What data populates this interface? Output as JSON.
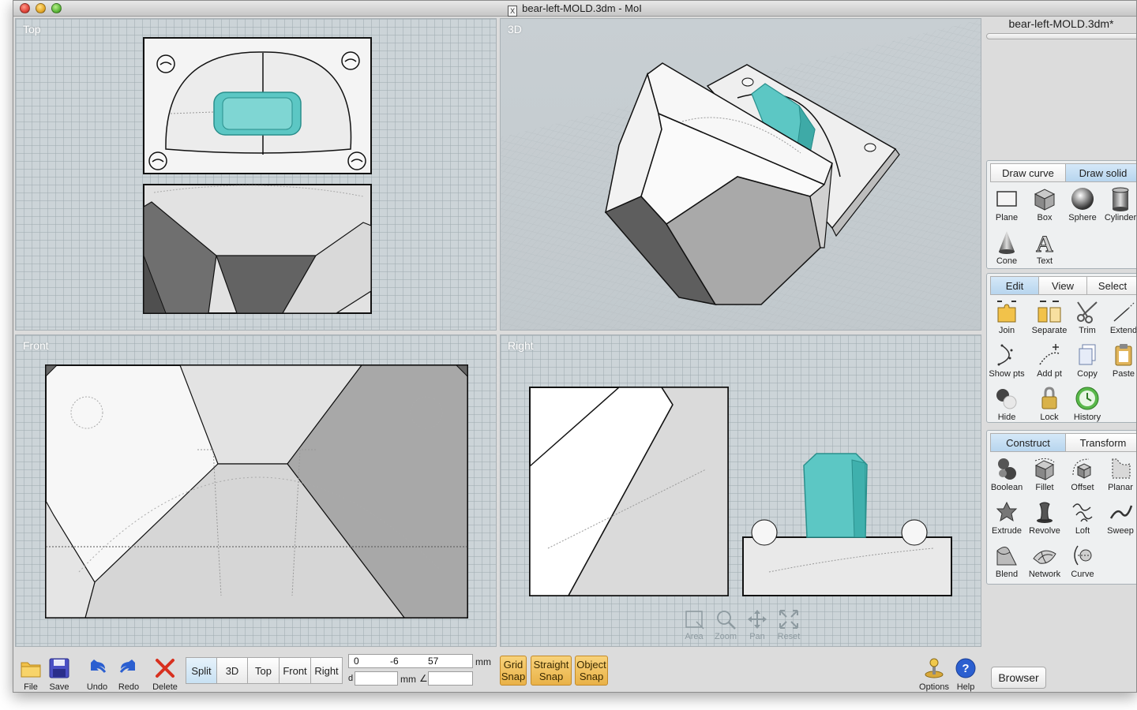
{
  "window": {
    "title": "bear-left-MOLD.3dm - MoI",
    "icon_glyph": "X"
  },
  "viewports": {
    "top": "Top",
    "perspective": "3D",
    "front": "Front",
    "right": "Right"
  },
  "nav_tools": {
    "area": "Area",
    "zoom": "Zoom",
    "pan": "Pan",
    "reset": "Reset"
  },
  "toolbar": {
    "file": "File",
    "save": "Save",
    "undo": "Undo",
    "redo": "Redo",
    "delete": "Delete",
    "view_modes": [
      "Split",
      "3D",
      "Top",
      "Front",
      "Right"
    ],
    "active_view_mode": "Split",
    "coords": {
      "x": "0",
      "y": "-6",
      "z": "57",
      "unit": "mm"
    },
    "distance": {
      "label": "d",
      "value": "",
      "unit": "mm",
      "angle_symbol": "∠",
      "angle_value": ""
    },
    "snaps": [
      {
        "line1": "Grid",
        "line2": "Snap"
      },
      {
        "line1": "Straight",
        "line2": "Snap"
      },
      {
        "line1": "Object",
        "line2": "Snap"
      }
    ],
    "options": "Options",
    "help": "Help"
  },
  "panel": {
    "file_name": "bear-left-MOLD.3dm*",
    "draw_tabs": [
      "Draw curve",
      "Draw solid"
    ],
    "draw_active": "Draw solid",
    "draw_tools": [
      "Plane",
      "Box",
      "Sphere",
      "Cylinder",
      "Cone",
      "Text"
    ],
    "edit_tabs": [
      "Edit",
      "View",
      "Select"
    ],
    "edit_active": "Edit",
    "edit_tools": [
      "Join",
      "Separate",
      "Trim",
      "Extend",
      "Show pts",
      "Add pt",
      "Copy",
      "Paste",
      "Hide",
      "Lock",
      "History"
    ],
    "construct_tabs": [
      "Construct",
      "Transform"
    ],
    "construct_active": "Construct",
    "construct_tools": [
      "Boolean",
      "Fillet",
      "Offset",
      "Planar",
      "Extrude",
      "Revolve",
      "Loft",
      "Sweep",
      "Blend",
      "Network",
      "Curve"
    ],
    "browser_button": "Browser"
  },
  "colors": {
    "selected_object": "#5cc7c4",
    "snap_button": "#f0c05a",
    "active_tab": "#c4def2",
    "viewport_bg": "#ccd4d8"
  }
}
